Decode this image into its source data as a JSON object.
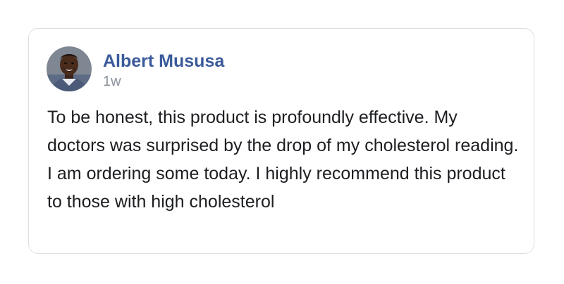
{
  "post": {
    "author_name": "Albert Mususa",
    "timestamp": "1w",
    "avatar_icon": "user-avatar-icon",
    "body": "To be honest, this product is profoundly effective. My doctors was surprised by the drop of my cholesterol reading. I am ordering some today. I highly recommend this product to those with high cholesterol"
  },
  "colors": {
    "author_name": "#3b5a9c",
    "timestamp": "#8d949e",
    "body_text": "#1c1e21",
    "card_border": "#dedfe2"
  }
}
